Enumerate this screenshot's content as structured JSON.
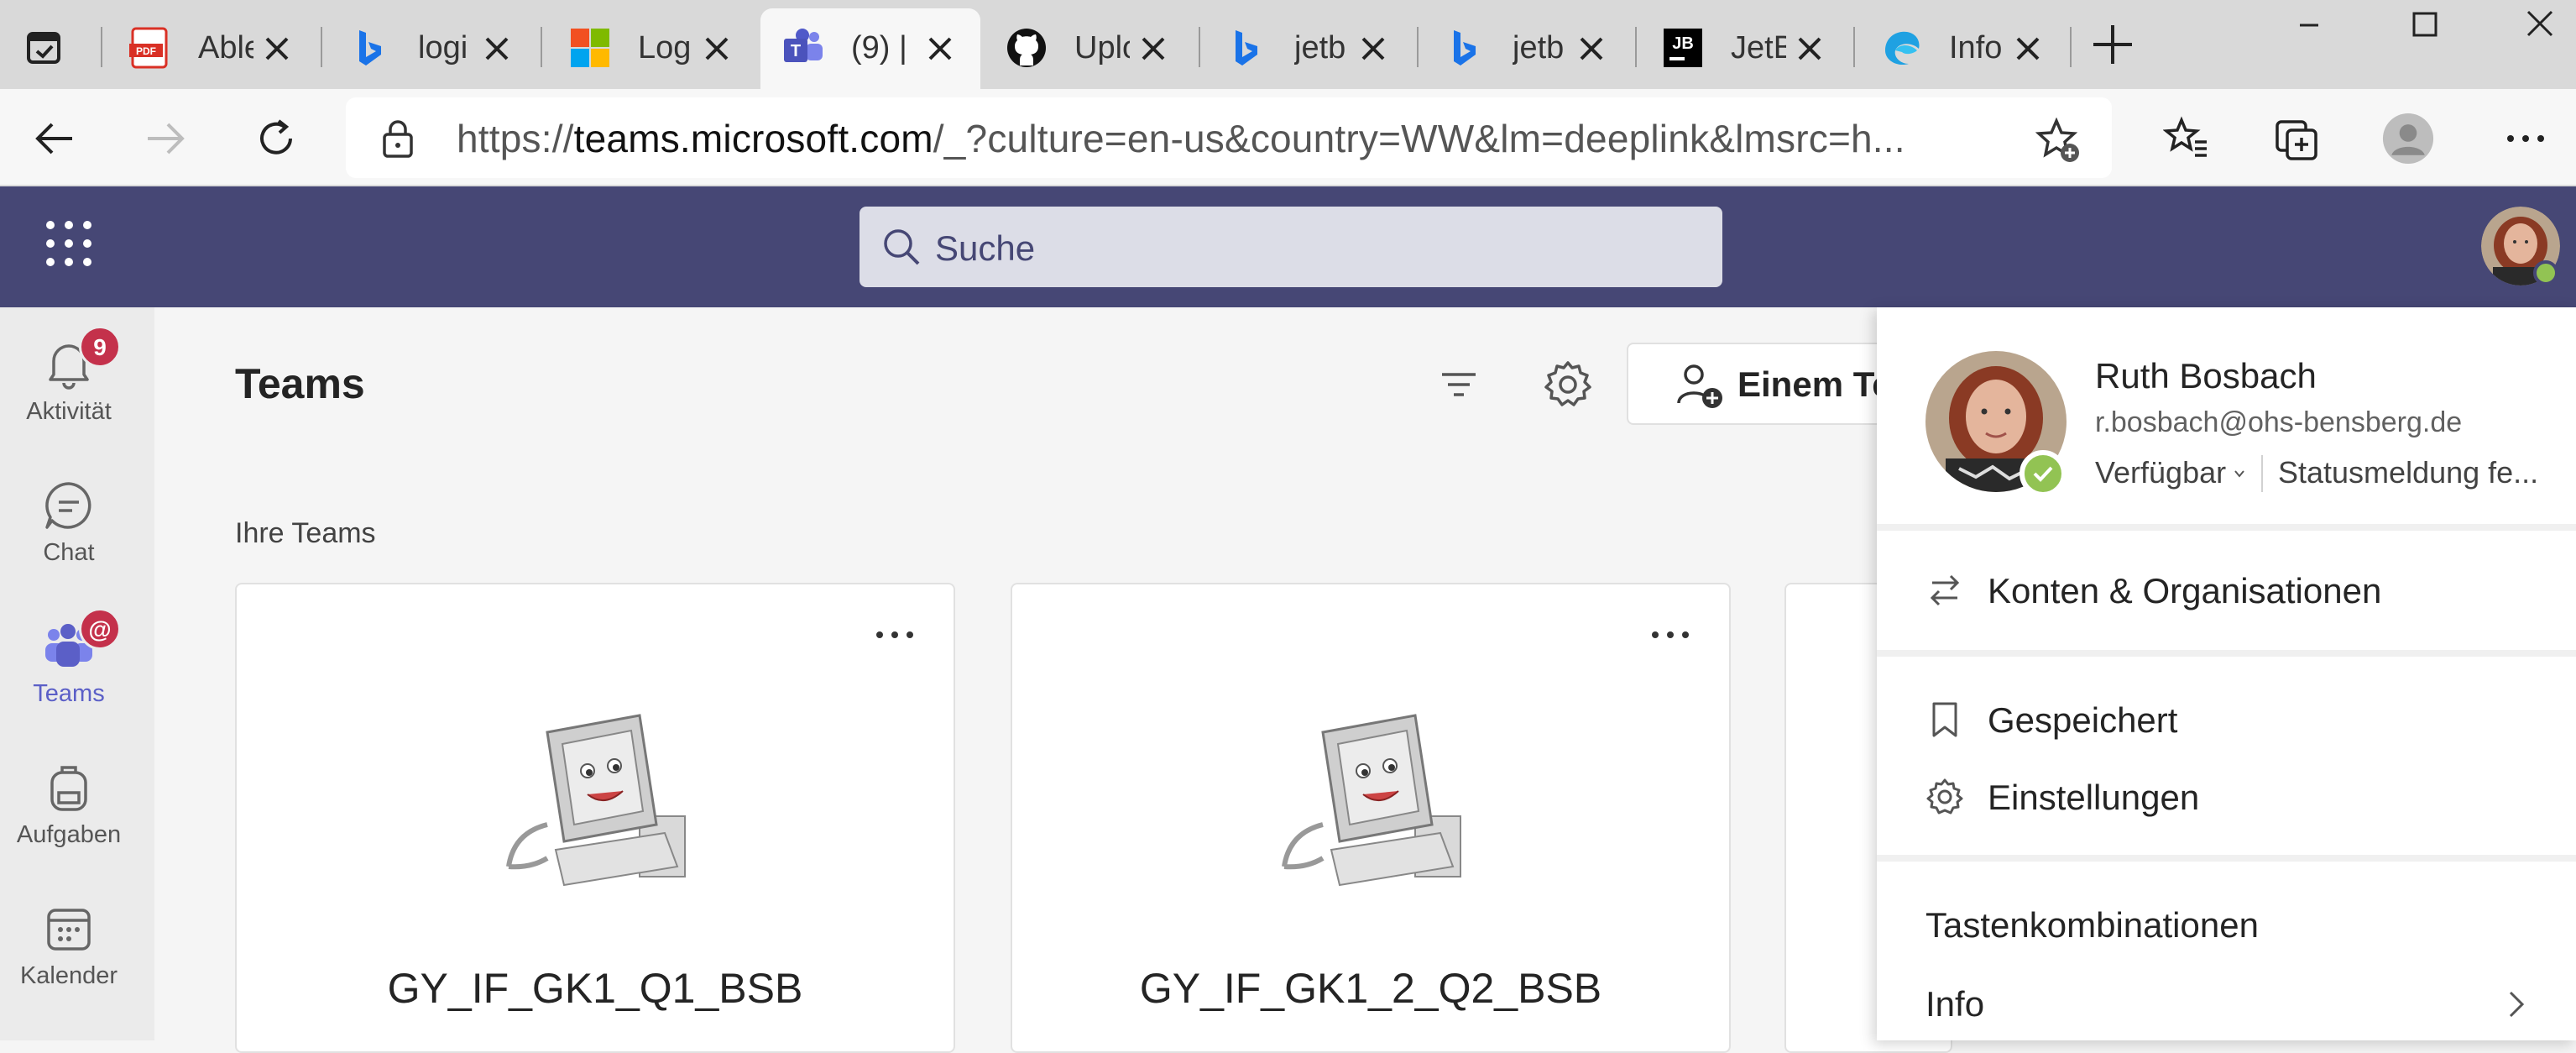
{
  "browser": {
    "tabs": [
      {
        "title": "Able",
        "favicon": "pdf-icon"
      },
      {
        "title": "logi",
        "favicon": "bing-icon"
      },
      {
        "title": "Log",
        "favicon": "microsoft-icon"
      },
      {
        "title": "(9) |",
        "favicon": "teams-icon",
        "active": true
      },
      {
        "title": "Uplo",
        "favicon": "github-icon"
      },
      {
        "title": "jetb",
        "favicon": "bing-icon"
      },
      {
        "title": "jetb",
        "favicon": "bing-icon"
      },
      {
        "title": "JetB",
        "favicon": "jetbrains-icon"
      },
      {
        "title": "Info",
        "favicon": "edge-icon"
      }
    ],
    "url_prefix": "https://",
    "url_domain": "teams.microsoft.com",
    "url_rest": "/_?culture=en-us&country=WW&lm=deeplink&lmsrc=h..."
  },
  "teams_header": {
    "search_placeholder": "Suche"
  },
  "rail": {
    "items": [
      {
        "label": "Aktivität",
        "icon": "bell-icon",
        "badge": "9"
      },
      {
        "label": "Chat",
        "icon": "chat-icon"
      },
      {
        "label": "Teams",
        "icon": "teams-icon",
        "badge": "@",
        "active": true
      },
      {
        "label": "Aufgaben",
        "icon": "backpack-icon"
      },
      {
        "label": "Kalender",
        "icon": "calendar-icon"
      }
    ]
  },
  "main": {
    "title": "Teams",
    "join_button": "Einem Te",
    "section_label": "Ihre Teams",
    "cards": [
      {
        "name": "GY_IF_GK1_Q1_BSB"
      },
      {
        "name": "GY_IF_GK1_2_Q2_BSB"
      }
    ]
  },
  "profile": {
    "name": "Ruth Bosbach",
    "email": "r.bosbach@ohs-bensberg.de",
    "availability": "Verfügbar",
    "status_message": "Statusmeldung fe...",
    "menu": {
      "accounts": "Konten & Organisationen",
      "saved": "Gespeichert",
      "settings": "Einstellungen",
      "shortcuts": "Tastenkombinationen",
      "info": "Info"
    }
  },
  "colors": {
    "teams_purple": "#464775",
    "accent": "#5b5fc7",
    "available_green": "#92c353",
    "badge_red": "#c4314b"
  }
}
